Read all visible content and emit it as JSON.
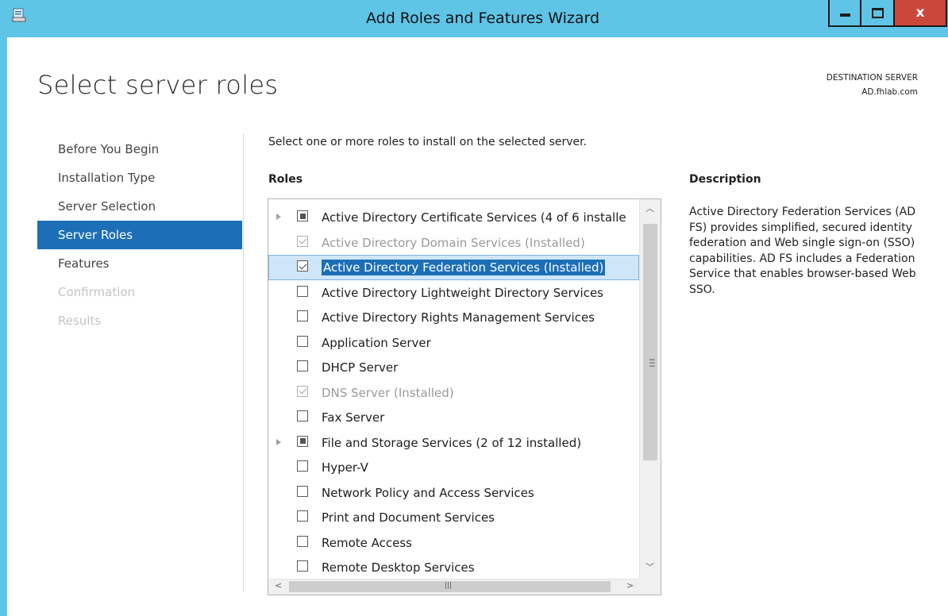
{
  "window": {
    "title": "Add Roles and Features Wizard",
    "buttons": {
      "minimize": "–",
      "maximize": "□",
      "close": "x"
    }
  },
  "page": {
    "title": "Select server roles",
    "destination_label": "DESTINATION SERVER",
    "destination_server": "AD.fhlab.com"
  },
  "nav": {
    "items": [
      {
        "label": "Before You Begin",
        "state": "normal"
      },
      {
        "label": "Installation Type",
        "state": "normal"
      },
      {
        "label": "Server Selection",
        "state": "normal"
      },
      {
        "label": "Server Roles",
        "state": "active"
      },
      {
        "label": "Features",
        "state": "normal"
      },
      {
        "label": "Confirmation",
        "state": "disabled"
      },
      {
        "label": "Results",
        "state": "disabled"
      }
    ]
  },
  "main": {
    "intro": "Select one or more roles to install on the selected server.",
    "roles_heading": "Roles",
    "roles": [
      {
        "label": "Active Directory Certificate Services (4 of 6 installe",
        "check": "partial",
        "expander": true,
        "grayed": false
      },
      {
        "label": "Active Directory Domain Services (Installed)",
        "check": "checked-gray",
        "expander": false,
        "grayed": true
      },
      {
        "label": "Active Directory Federation Services (Installed)",
        "check": "checked-dark",
        "expander": false,
        "grayed": false,
        "selected": true
      },
      {
        "label": "Active Directory Lightweight Directory Services",
        "check": "unchecked",
        "expander": false,
        "grayed": false
      },
      {
        "label": "Active Directory Rights Management Services",
        "check": "unchecked",
        "expander": false,
        "grayed": false
      },
      {
        "label": "Application Server",
        "check": "unchecked",
        "expander": false,
        "grayed": false
      },
      {
        "label": "DHCP Server",
        "check": "unchecked",
        "expander": false,
        "grayed": false
      },
      {
        "label": "DNS Server (Installed)",
        "check": "checked-gray",
        "expander": false,
        "grayed": true
      },
      {
        "label": "Fax Server",
        "check": "unchecked",
        "expander": false,
        "grayed": false
      },
      {
        "label": "File and Storage Services (2 of 12 installed)",
        "check": "partial",
        "expander": true,
        "grayed": false
      },
      {
        "label": "Hyper-V",
        "check": "unchecked",
        "expander": false,
        "grayed": false
      },
      {
        "label": "Network Policy and Access Services",
        "check": "unchecked",
        "expander": false,
        "grayed": false
      },
      {
        "label": "Print and Document Services",
        "check": "unchecked",
        "expander": false,
        "grayed": false
      },
      {
        "label": "Remote Access",
        "check": "unchecked",
        "expander": false,
        "grayed": false
      },
      {
        "label": "Remote Desktop Services",
        "check": "unchecked",
        "expander": false,
        "grayed": false
      }
    ]
  },
  "description": {
    "heading": "Description",
    "text": "Active Directory Federation Services (AD FS) provides simplified, secured identity federation and Web single sign-on (SSO) capabilities. AD FS includes a Federation Service that enables browser-based Web SSO."
  },
  "colors": {
    "titlebar": "#5fc4e6",
    "nav_active": "#1c6fb7",
    "close_button": "#c9473b"
  }
}
